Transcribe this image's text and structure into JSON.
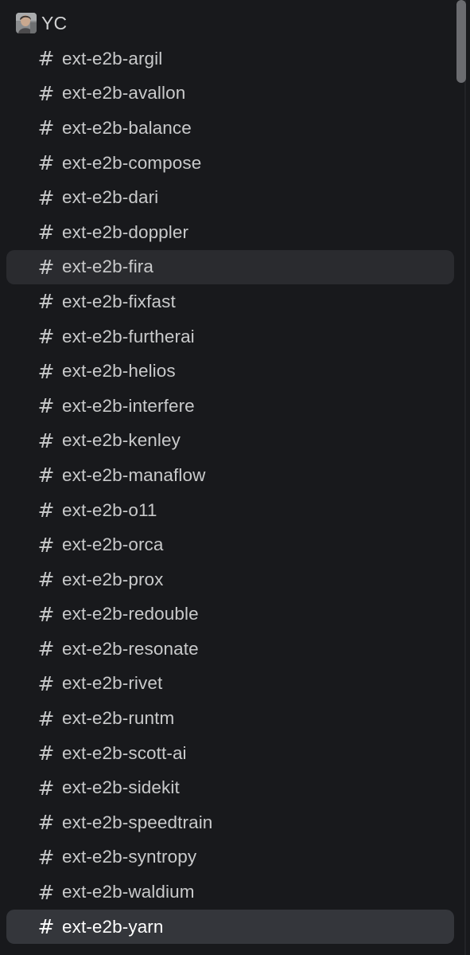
{
  "section": {
    "title": "YC",
    "avatar_icon": "user-avatar-icon"
  },
  "channels": [
    {
      "name": "ext-e2b-argil"
    },
    {
      "name": "ext-e2b-avallon"
    },
    {
      "name": "ext-e2b-balance"
    },
    {
      "name": "ext-e2b-compose"
    },
    {
      "name": "ext-e2b-dari"
    },
    {
      "name": "ext-e2b-doppler"
    },
    {
      "name": "ext-e2b-fira"
    },
    {
      "name": "ext-e2b-fixfast"
    },
    {
      "name": "ext-e2b-furtherai"
    },
    {
      "name": "ext-e2b-helios"
    },
    {
      "name": "ext-e2b-interfere"
    },
    {
      "name": "ext-e2b-kenley"
    },
    {
      "name": "ext-e2b-manaflow"
    },
    {
      "name": "ext-e2b-o11"
    },
    {
      "name": "ext-e2b-orca"
    },
    {
      "name": "ext-e2b-prox"
    },
    {
      "name": "ext-e2b-redouble"
    },
    {
      "name": "ext-e2b-resonate"
    },
    {
      "name": "ext-e2b-rivet"
    },
    {
      "name": "ext-e2b-runtm"
    },
    {
      "name": "ext-e2b-scott-ai"
    },
    {
      "name": "ext-e2b-sidekit"
    },
    {
      "name": "ext-e2b-speedtrain"
    },
    {
      "name": "ext-e2b-syntropy"
    },
    {
      "name": "ext-e2b-waldium"
    },
    {
      "name": "ext-e2b-yarn"
    }
  ],
  "channel_prefix_icon": "hash-icon",
  "hash_symbol": "#",
  "colors": {
    "background": "#18191c",
    "hover_row": "#2a2b2f",
    "selected_row": "#34363b",
    "text": "#c9cacb",
    "scrollbar_thumb": "#6b6c70"
  }
}
